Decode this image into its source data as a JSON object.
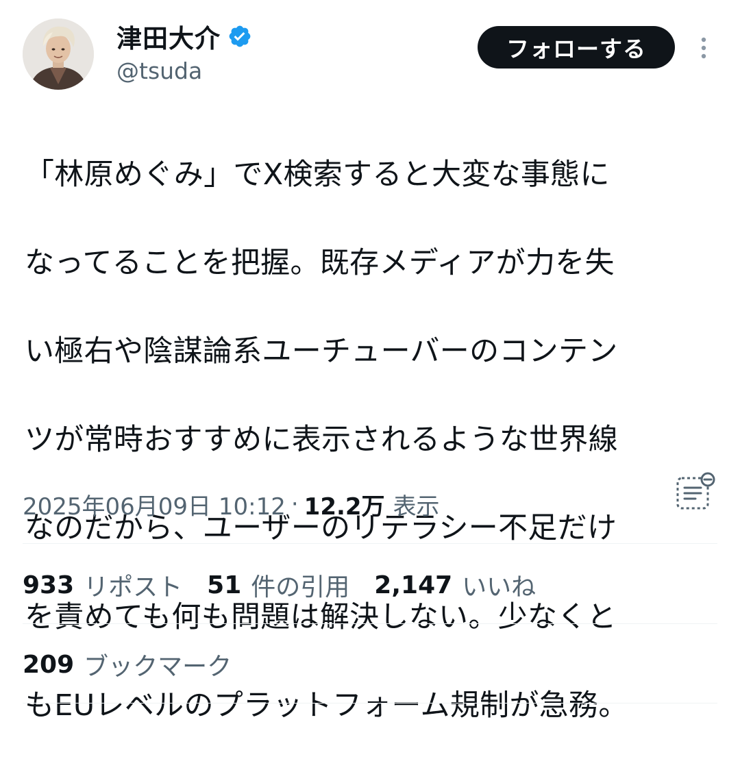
{
  "author": {
    "display_name": "津田大介",
    "handle": "@tsuda",
    "verified": true
  },
  "follow_button": {
    "label": "フォローする"
  },
  "tweet": {
    "lines": [
      "「林原めぐみ」でX検索すると大変な事態に",
      "なってることを把握。既存メディアが力を失",
      "い極右や陰謀論系ユーチューバーのコンテン",
      "ツが常時おすすめに表示されるような世界線",
      "なのだから、ユーザーのリテラシー不足だけ",
      "を責めても何も問題は解決しない。少なくと",
      "もEUレベルのプラットフォーム規制が急務。"
    ]
  },
  "meta": {
    "timestamp": "2025年06月09日 10:12",
    "separator": "·",
    "views_count": "12.2万",
    "views_label": "表示"
  },
  "stats": {
    "reposts": {
      "count": "933",
      "label": "リポスト"
    },
    "quotes": {
      "count": "51",
      "label": "件の引用"
    },
    "likes": {
      "count": "2,147",
      "label": "いいね"
    },
    "bookmarks": {
      "count": "209",
      "label": "ブックマーク"
    }
  },
  "icons": {
    "verified": "verified-badge-icon",
    "more": "more-vertical-icon",
    "summary": "post-summary-icon"
  },
  "colors": {
    "text": "#0f1419",
    "secondary": "#536471",
    "verified": "#1d9bf0",
    "follow_bg": "#0f1419",
    "divider": "#eff3f4"
  }
}
